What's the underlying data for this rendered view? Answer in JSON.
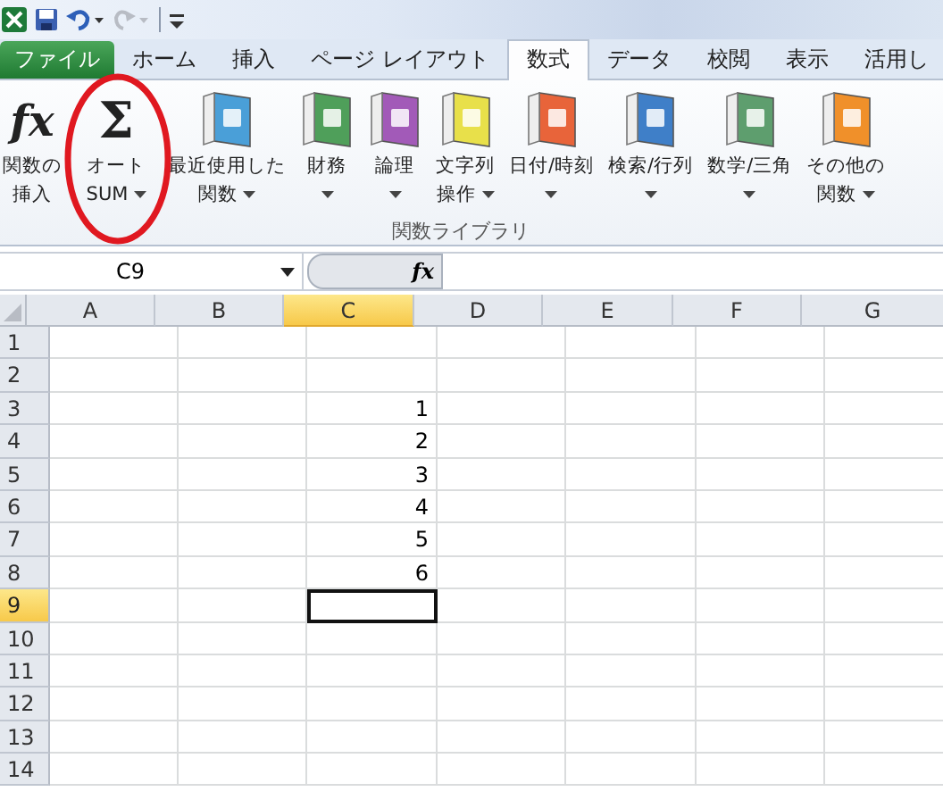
{
  "quick_access": {
    "redo_disabled": true
  },
  "tabs": [
    {
      "label": "ファイル",
      "kind": "file",
      "selected": false
    },
    {
      "label": "ホーム",
      "kind": "tab",
      "selected": false
    },
    {
      "label": "挿入",
      "kind": "tab",
      "selected": false
    },
    {
      "label": "ページ レイアウト",
      "kind": "tab",
      "selected": false
    },
    {
      "label": "数式",
      "kind": "tab",
      "selected": true
    },
    {
      "label": "データ",
      "kind": "tab",
      "selected": false
    },
    {
      "label": "校閲",
      "kind": "tab",
      "selected": false
    },
    {
      "label": "表示",
      "kind": "tab",
      "selected": false
    },
    {
      "label": "活用し",
      "kind": "tab",
      "selected": false
    }
  ],
  "ribbon": {
    "group_label": "関数ライブラリ",
    "buttons": [
      {
        "kind": "glyph",
        "glyph": "fx",
        "lines": [
          "関数の",
          "挿入"
        ],
        "dropdown": false
      },
      {
        "kind": "glyph",
        "glyph": "Σ",
        "lines": [
          "オート",
          "SUM"
        ],
        "dropdown": true
      },
      {
        "kind": "book",
        "color": "#4a9fd8",
        "lines": [
          "最近使用した",
          "関数"
        ],
        "dropdown": true
      },
      {
        "kind": "book",
        "color": "#4f9f5a",
        "lines": [
          "財務"
        ],
        "dropdown": true
      },
      {
        "kind": "book",
        "color": "#a25ab8",
        "lines": [
          "論理"
        ],
        "dropdown": true
      },
      {
        "kind": "book",
        "color": "#e8e04a",
        "lines": [
          "文字列",
          "操作"
        ],
        "dropdown": true
      },
      {
        "kind": "book",
        "color": "#e8643a",
        "lines": [
          "日付/時刻"
        ],
        "dropdown": true
      },
      {
        "kind": "book",
        "color": "#3f7fc8",
        "lines": [
          "検索/行列"
        ],
        "dropdown": true
      },
      {
        "kind": "book",
        "color": "#5e9e6e",
        "lines": [
          "数学/三角"
        ],
        "dropdown": true
      },
      {
        "kind": "book",
        "color": "#f0902a",
        "lines": [
          "その他の",
          "関数"
        ],
        "dropdown": true
      }
    ]
  },
  "annotation": {
    "kind": "ellipse",
    "color": "#e01820"
  },
  "formula_bar": {
    "name_box": "C9",
    "function_button": "fx"
  },
  "columns": [
    {
      "label": "A",
      "selected": false
    },
    {
      "label": "B",
      "selected": false
    },
    {
      "label": "C",
      "selected": true
    },
    {
      "label": "D",
      "selected": false
    },
    {
      "label": "E",
      "selected": false
    },
    {
      "label": "F",
      "selected": false
    },
    {
      "label": "G",
      "selected": false
    }
  ],
  "rows": [
    {
      "header": "1",
      "selected": false,
      "cells": {}
    },
    {
      "header": "2",
      "selected": false,
      "cells": {}
    },
    {
      "header": "3",
      "selected": false,
      "cells": {
        "C": "1"
      }
    },
    {
      "header": "4",
      "selected": false,
      "cells": {
        "C": "2"
      }
    },
    {
      "header": "5",
      "selected": false,
      "cells": {
        "C": "3"
      }
    },
    {
      "header": "6",
      "selected": false,
      "cells": {
        "C": "4"
      }
    },
    {
      "header": "7",
      "selected": false,
      "cells": {
        "C": "5"
      }
    },
    {
      "header": "8",
      "selected": false,
      "cells": {
        "C": "6"
      }
    },
    {
      "header": "9",
      "selected": true,
      "cells": {}
    },
    {
      "header": "10",
      "selected": false,
      "cells": {}
    },
    {
      "header": "11",
      "selected": false,
      "cells": {}
    },
    {
      "header": "12",
      "selected": false,
      "cells": {}
    },
    {
      "header": "13",
      "selected": false,
      "cells": {}
    },
    {
      "header": "14",
      "selected": false,
      "cells": {}
    }
  ]
}
